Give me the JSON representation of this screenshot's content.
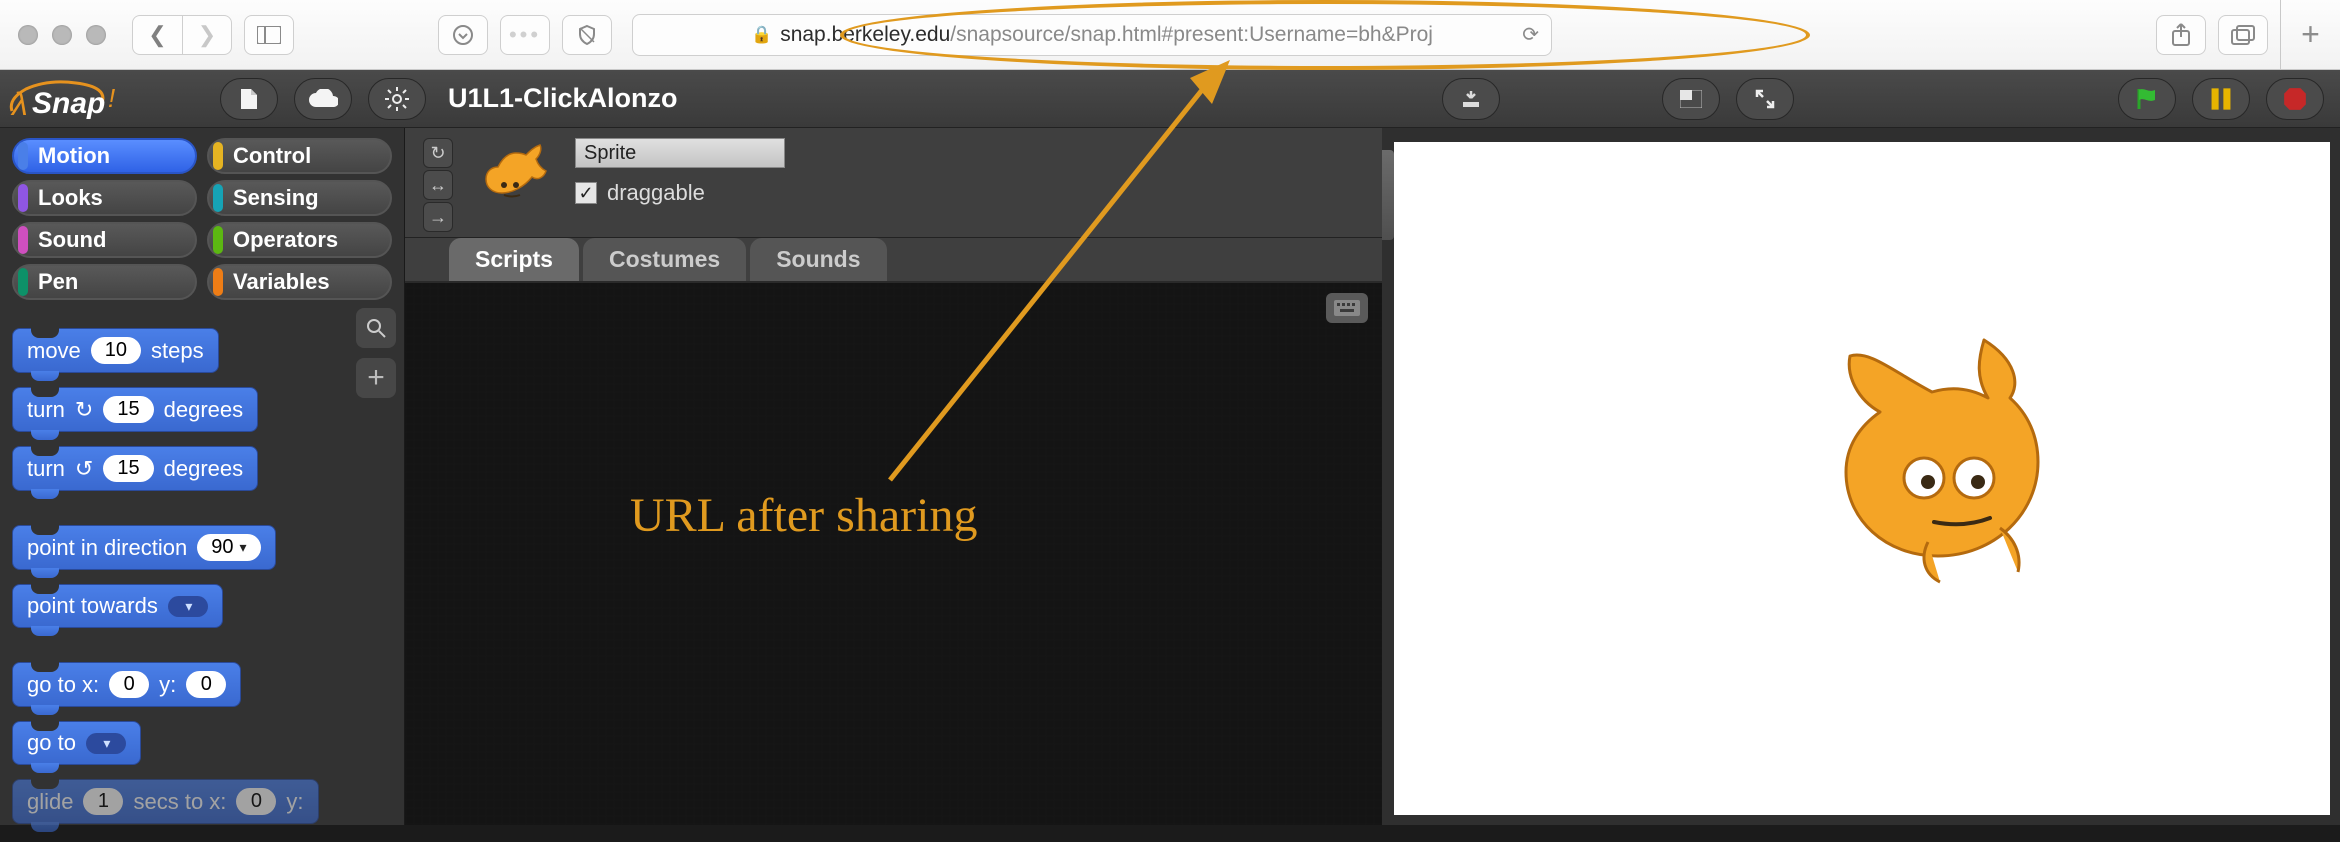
{
  "browser": {
    "url_host": "snap.berkeley.edu",
    "url_path": "/snapsource/snap.html#present:Username=bh&Proj"
  },
  "annotation": {
    "label": "URL after sharing"
  },
  "snap": {
    "project_title": "U1L1-ClickAlonzo",
    "categories": [
      {
        "name": "Motion",
        "color": "#4a7fe8",
        "active": true
      },
      {
        "name": "Control",
        "color": "#e6b422"
      },
      {
        "name": "Looks",
        "color": "#8f56e3"
      },
      {
        "name": "Sensing",
        "color": "#16a3b5"
      },
      {
        "name": "Sound",
        "color": "#cf4fbf"
      },
      {
        "name": "Operators",
        "color": "#5cb712"
      },
      {
        "name": "Pen",
        "color": "#0d9168"
      },
      {
        "name": "Variables",
        "color": "#ee7d16"
      }
    ],
    "blocks": {
      "move_label_a": "move",
      "move_val": "10",
      "move_label_b": "steps",
      "turn_cw_a": "turn",
      "turn_cw_val": "15",
      "turn_cw_b": "degrees",
      "turn_ccw_a": "turn",
      "turn_ccw_val": "15",
      "turn_ccw_b": "degrees",
      "point_dir_a": "point in direction",
      "point_dir_val": "90",
      "point_towards": "point towards",
      "goto_xy_a": "go to x:",
      "goto_xy_x": "0",
      "goto_xy_b": "y:",
      "goto_xy_y": "0",
      "go_to": "go to",
      "glide_a": "glide",
      "glide_secs": "1",
      "glide_b": "secs to x:",
      "glide_x": "0",
      "glide_c": "y:"
    },
    "sprite": {
      "name": "Sprite",
      "draggable_label": "draggable",
      "draggable_checked": true
    },
    "tabs": {
      "scripts": "Scripts",
      "costumes": "Costumes",
      "sounds": "Sounds"
    }
  }
}
